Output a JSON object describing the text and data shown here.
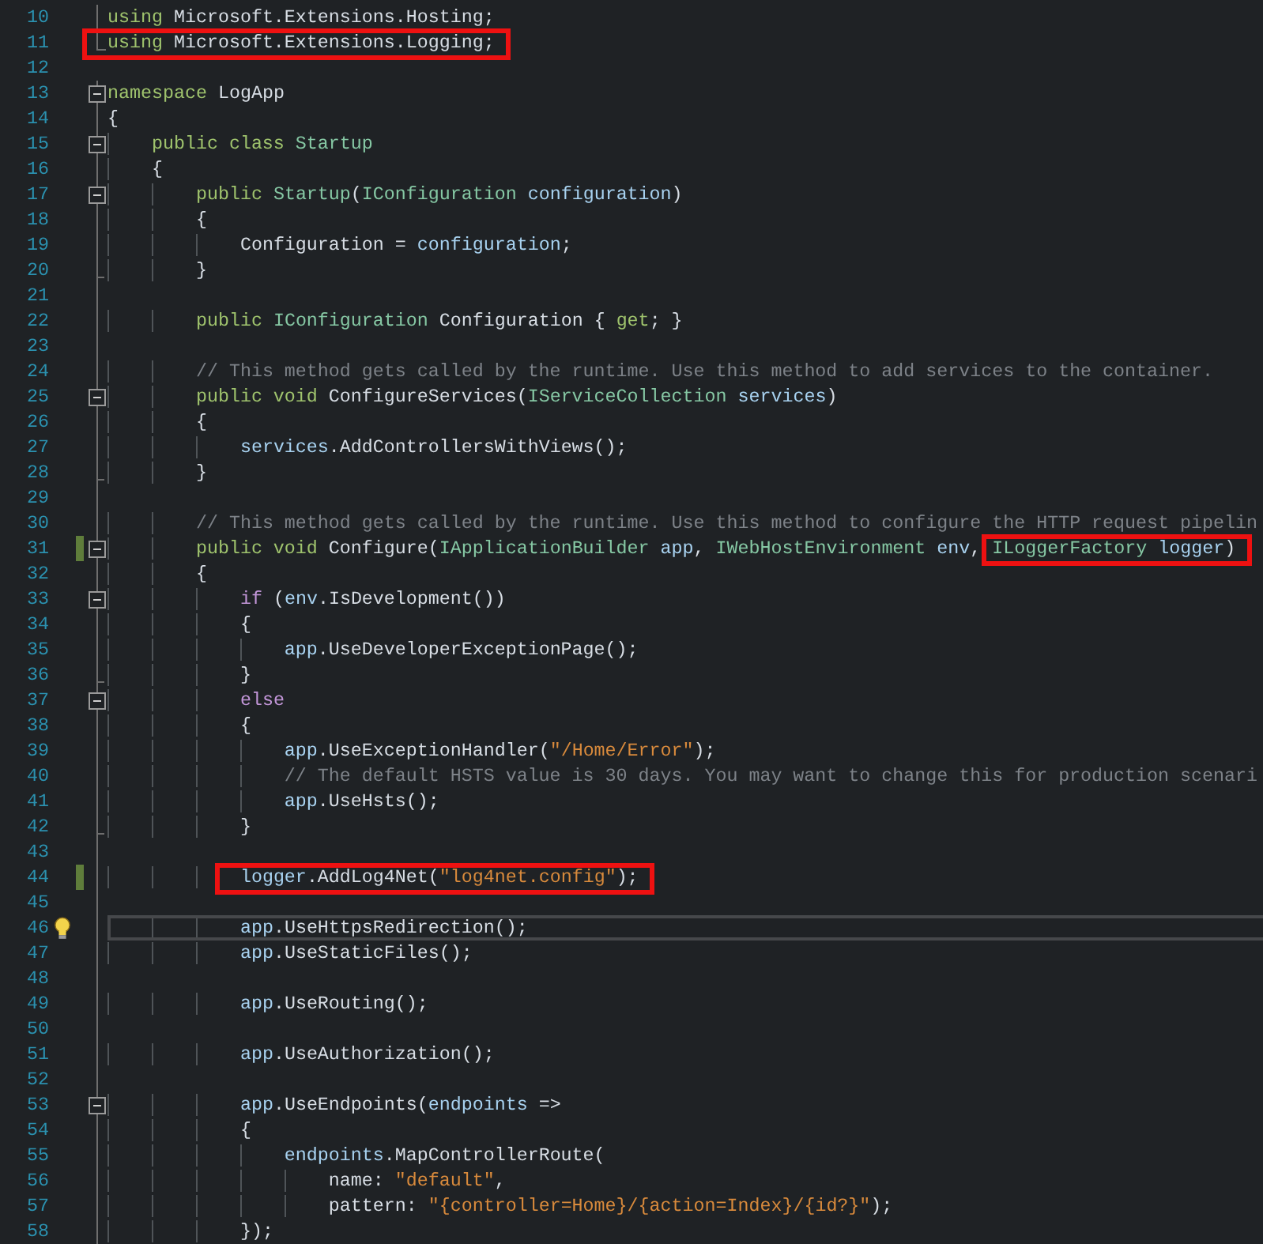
{
  "lines": [
    {
      "number": "10",
      "kind": "line",
      "tokens": [
        {
          "kind": "keyword",
          "text": "using"
        },
        {
          "kind": "plain",
          "text": " Microsoft.Extensions.Hosting;"
        }
      ]
    },
    {
      "number": "11",
      "kind": "end",
      "tokens": [
        {
          "kind": "keyword",
          "text": "using",
          "boxed": true
        },
        {
          "kind": "plain",
          "text": " Microsoft.Extensions.Logging;",
          "boxed": true
        }
      ]
    },
    {
      "number": "12"
    },
    {
      "number": "13",
      "kind": "open",
      "tokens": [
        {
          "kind": "keyword",
          "text": "namespace"
        },
        {
          "kind": "plain",
          "text": " LogApp"
        }
      ]
    },
    {
      "number": "14",
      "kind": "line",
      "tokens": [
        {
          "kind": "plain",
          "text": "{"
        }
      ]
    },
    {
      "number": "15",
      "kind": "open",
      "tokens": [
        {
          "kind": "keyword",
          "text": "    public class"
        },
        {
          "kind": "type",
          "text": " Startup"
        }
      ]
    },
    {
      "number": "16",
      "kind": "line",
      "tokens": [
        {
          "kind": "plain",
          "text": "    {"
        }
      ]
    },
    {
      "number": "17",
      "kind": "open",
      "tokens": [
        {
          "kind": "keyword",
          "text": "        public"
        },
        {
          "kind": "type",
          "text": " Startup"
        },
        {
          "kind": "plain",
          "text": "("
        },
        {
          "kind": "type",
          "text": "IConfiguration"
        },
        {
          "kind": "param",
          "text": " configuration"
        },
        {
          "kind": "plain",
          "text": ")"
        }
      ]
    },
    {
      "number": "18",
      "kind": "line",
      "tokens": [
        {
          "kind": "plain",
          "text": "        {"
        }
      ]
    },
    {
      "number": "19",
      "kind": "line",
      "tokens": [
        {
          "kind": "plain",
          "text": "            Configuration = "
        },
        {
          "kind": "param",
          "text": "configuration"
        },
        {
          "kind": "plain",
          "text": ";"
        }
      ]
    },
    {
      "number": "20",
      "kind": "tick",
      "tokens": [
        {
          "kind": "plain",
          "text": "        }"
        }
      ]
    },
    {
      "number": "21",
      "kind": "line"
    },
    {
      "number": "22",
      "kind": "line",
      "tokens": [
        {
          "kind": "keyword",
          "text": "        public"
        },
        {
          "kind": "type",
          "text": " IConfiguration"
        },
        {
          "kind": "plain",
          "text": " Configuration { "
        },
        {
          "kind": "keyword",
          "text": "get"
        },
        {
          "kind": "plain",
          "text": "; }"
        }
      ]
    },
    {
      "number": "23",
      "kind": "line"
    },
    {
      "number": "24",
      "kind": "line",
      "tokens": [
        {
          "kind": "comment",
          "text": "        // This method gets called by the runtime. Use this method to add services to the container."
        }
      ]
    },
    {
      "number": "25",
      "kind": "open",
      "tokens": [
        {
          "kind": "keyword",
          "text": "        public void"
        },
        {
          "kind": "plain",
          "text": " ConfigureServices("
        },
        {
          "kind": "type",
          "text": "IServiceCollection"
        },
        {
          "kind": "param",
          "text": " services"
        },
        {
          "kind": "plain",
          "text": ")"
        }
      ]
    },
    {
      "number": "26",
      "kind": "line",
      "tokens": [
        {
          "kind": "plain",
          "text": "        {"
        }
      ]
    },
    {
      "number": "27",
      "kind": "line",
      "tokens": [
        {
          "kind": "param",
          "text": "            services"
        },
        {
          "kind": "plain",
          "text": ".AddControllersWithViews();"
        }
      ]
    },
    {
      "number": "28",
      "kind": "tick",
      "tokens": [
        {
          "kind": "plain",
          "text": "        }"
        }
      ]
    },
    {
      "number": "29",
      "kind": "line"
    },
    {
      "number": "30",
      "kind": "line",
      "tokens": [
        {
          "kind": "comment",
          "text": "        // This method gets called by the runtime. Use this method to configure the HTTP request pipelin"
        }
      ]
    },
    {
      "number": "31",
      "kind": "open",
      "changed": true,
      "tokens": [
        {
          "kind": "keyword",
          "text": "        public void"
        },
        {
          "kind": "plain",
          "text": " Configure("
        },
        {
          "kind": "type",
          "text": "IApplicationBuilder"
        },
        {
          "kind": "param",
          "text": " app"
        },
        {
          "kind": "plain",
          "text": ", "
        },
        {
          "kind": "type",
          "text": "IWebHostEnvironment"
        },
        {
          "kind": "param",
          "text": " env"
        },
        {
          "kind": "plain",
          "text": ", "
        },
        {
          "kind": "type",
          "text": "ILoggerFactory",
          "boxed": true
        },
        {
          "kind": "param",
          "text": " logger",
          "boxed": true
        },
        {
          "kind": "plain",
          "text": ")",
          "boxed": true
        }
      ]
    },
    {
      "number": "32",
      "kind": "line",
      "tokens": [
        {
          "kind": "plain",
          "text": "        {"
        }
      ]
    },
    {
      "number": "33",
      "kind": "open",
      "tokens": [
        {
          "kind": "control",
          "text": "            if"
        },
        {
          "kind": "plain",
          "text": " ("
        },
        {
          "kind": "param",
          "text": "env"
        },
        {
          "kind": "plain",
          "text": ".IsDevelopment())"
        }
      ]
    },
    {
      "number": "34",
      "kind": "line",
      "tokens": [
        {
          "kind": "plain",
          "text": "            {"
        }
      ]
    },
    {
      "number": "35",
      "kind": "line",
      "tokens": [
        {
          "kind": "param",
          "text": "                app"
        },
        {
          "kind": "plain",
          "text": ".UseDeveloperExceptionPage();"
        }
      ]
    },
    {
      "number": "36",
      "kind": "tick",
      "tokens": [
        {
          "kind": "plain",
          "text": "            }"
        }
      ]
    },
    {
      "number": "37",
      "kind": "open",
      "tokens": [
        {
          "kind": "control",
          "text": "            else"
        }
      ]
    },
    {
      "number": "38",
      "kind": "line",
      "tokens": [
        {
          "kind": "plain",
          "text": "            {"
        }
      ]
    },
    {
      "number": "39",
      "kind": "line",
      "tokens": [
        {
          "kind": "param",
          "text": "                app"
        },
        {
          "kind": "plain",
          "text": ".UseExceptionHandler("
        },
        {
          "kind": "string",
          "text": "\"/Home/Error\""
        },
        {
          "kind": "plain",
          "text": ");"
        }
      ]
    },
    {
      "number": "40",
      "kind": "line",
      "tokens": [
        {
          "kind": "comment",
          "text": "                // The default HSTS value is 30 days. You may want to change this for production scenari"
        }
      ]
    },
    {
      "number": "41",
      "kind": "line",
      "tokens": [
        {
          "kind": "param",
          "text": "                app"
        },
        {
          "kind": "plain",
          "text": ".UseHsts();"
        }
      ]
    },
    {
      "number": "42",
      "kind": "tick",
      "tokens": [
        {
          "kind": "plain",
          "text": "            }"
        }
      ]
    },
    {
      "number": "43",
      "kind": "line"
    },
    {
      "number": "44",
      "kind": "line",
      "changed": true,
      "tokens": [
        {
          "kind": "param",
          "text": "            logger",
          "boxed": true
        },
        {
          "kind": "plain",
          "text": ".AddLog4Net(",
          "boxed": true
        },
        {
          "kind": "string",
          "text": "\"log4net.config\"",
          "boxed": true
        },
        {
          "kind": "plain",
          "text": ");",
          "boxed": true
        }
      ]
    },
    {
      "number": "45",
      "kind": "line"
    },
    {
      "number": "46",
      "kind": "line",
      "lightbulb": true,
      "current": true,
      "tokens": [
        {
          "kind": "param",
          "text": "            app"
        },
        {
          "kind": "plain",
          "text": ".UseHttpsRedirection();"
        }
      ]
    },
    {
      "number": "47",
      "kind": "line",
      "tokens": [
        {
          "kind": "param",
          "text": "            app"
        },
        {
          "kind": "plain",
          "text": ".UseStaticFiles();"
        }
      ]
    },
    {
      "number": "48",
      "kind": "line"
    },
    {
      "number": "49",
      "kind": "line",
      "tokens": [
        {
          "kind": "param",
          "text": "            app"
        },
        {
          "kind": "plain",
          "text": ".UseRouting();"
        }
      ]
    },
    {
      "number": "50",
      "kind": "line"
    },
    {
      "number": "51",
      "kind": "line",
      "tokens": [
        {
          "kind": "param",
          "text": "            app"
        },
        {
          "kind": "plain",
          "text": ".UseAuthorization();"
        }
      ]
    },
    {
      "number": "52",
      "kind": "line"
    },
    {
      "number": "53",
      "kind": "open",
      "tokens": [
        {
          "kind": "param",
          "text": "            app"
        },
        {
          "kind": "plain",
          "text": ".UseEndpoints("
        },
        {
          "kind": "param",
          "text": "endpoints"
        },
        {
          "kind": "plain",
          "text": " =>"
        }
      ]
    },
    {
      "number": "54",
      "kind": "line",
      "tokens": [
        {
          "kind": "plain",
          "text": "            {"
        }
      ]
    },
    {
      "number": "55",
      "kind": "line",
      "tokens": [
        {
          "kind": "param",
          "text": "                endpoints"
        },
        {
          "kind": "plain",
          "text": ".MapControllerRoute("
        }
      ]
    },
    {
      "number": "56",
      "kind": "line",
      "tokens": [
        {
          "kind": "plain",
          "text": "                    name: "
        },
        {
          "kind": "string",
          "text": "\"default\""
        },
        {
          "kind": "plain",
          "text": ","
        }
      ]
    },
    {
      "number": "57",
      "kind": "line",
      "tokens": [
        {
          "kind": "plain",
          "text": "                    pattern: "
        },
        {
          "kind": "string",
          "text": "\"{controller=Home}/{action=Index}/{id?}\""
        },
        {
          "kind": "plain",
          "text": ");"
        }
      ]
    },
    {
      "number": "58",
      "kind": "line",
      "tokens": [
        {
          "kind": "plain",
          "text": "            });"
        }
      ]
    }
  ]
}
